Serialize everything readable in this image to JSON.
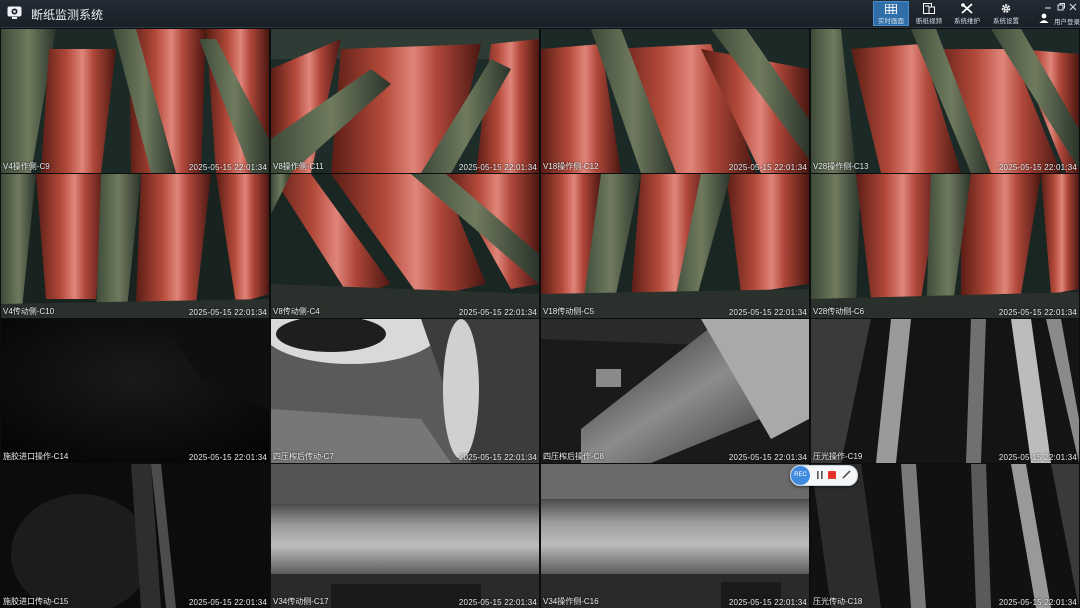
{
  "app": {
    "title": "断纸监测系统"
  },
  "nav": [
    {
      "label": "实时画面",
      "icon": "grid-icon"
    },
    {
      "label": "断纸视频",
      "icon": "video-list-icon"
    },
    {
      "label": "系统维护",
      "icon": "tools-icon"
    },
    {
      "label": "系统设置",
      "icon": "gear-icon"
    }
  ],
  "user": {
    "label": "用户登录",
    "icon": "user-icon"
  },
  "cameras": [
    {
      "name": "V4操作侧-C9",
      "time": "2025-05-15 22:01:34"
    },
    {
      "name": "V8操作侧-C11",
      "time": "2025-05-15 22:01:34"
    },
    {
      "name": "V18操作侧-C12",
      "time": "2025-05-15 22:01:34"
    },
    {
      "name": "V28操作侧-C13",
      "time": "2025-05-15 22:01:34"
    },
    {
      "name": "V4传动侧-C10",
      "time": "2025-05-15 22:01:34"
    },
    {
      "name": "V8传动侧-C4",
      "time": "2025-05-15 22:01:34"
    },
    {
      "name": "V18传动侧-C5",
      "time": "2025-05-15 22:01:34"
    },
    {
      "name": "V28传动侧-C6",
      "time": "2025-05-15 22:01:34"
    },
    {
      "name": "施胶进口操作-C14",
      "time": "2025-05-15 22:01:34"
    },
    {
      "name": "四压榨后传动-C7",
      "time": "2025-05-15 22:01:34"
    },
    {
      "name": "四压榨后操作-C8",
      "time": "2025-05-15 22:01:34"
    },
    {
      "name": "压光操作-C19",
      "time": "2025-05-15 22:01:34"
    },
    {
      "name": "施胶进口传动-C15",
      "time": "2025-05-15 22:01:34"
    },
    {
      "name": "V34传动侧-C17",
      "time": "2025-05-15 22:01:34"
    },
    {
      "name": "V34操作侧-C16",
      "time": "2025-05-15 22:01:34"
    },
    {
      "name": "压光传动-C18",
      "time": "2025-05-15 22:01:34"
    }
  ],
  "recorder": {
    "badge": "REC"
  },
  "colors": {
    "accent": "#2f6ea8",
    "roller": "#b8483a",
    "stop": "#e8322c"
  }
}
